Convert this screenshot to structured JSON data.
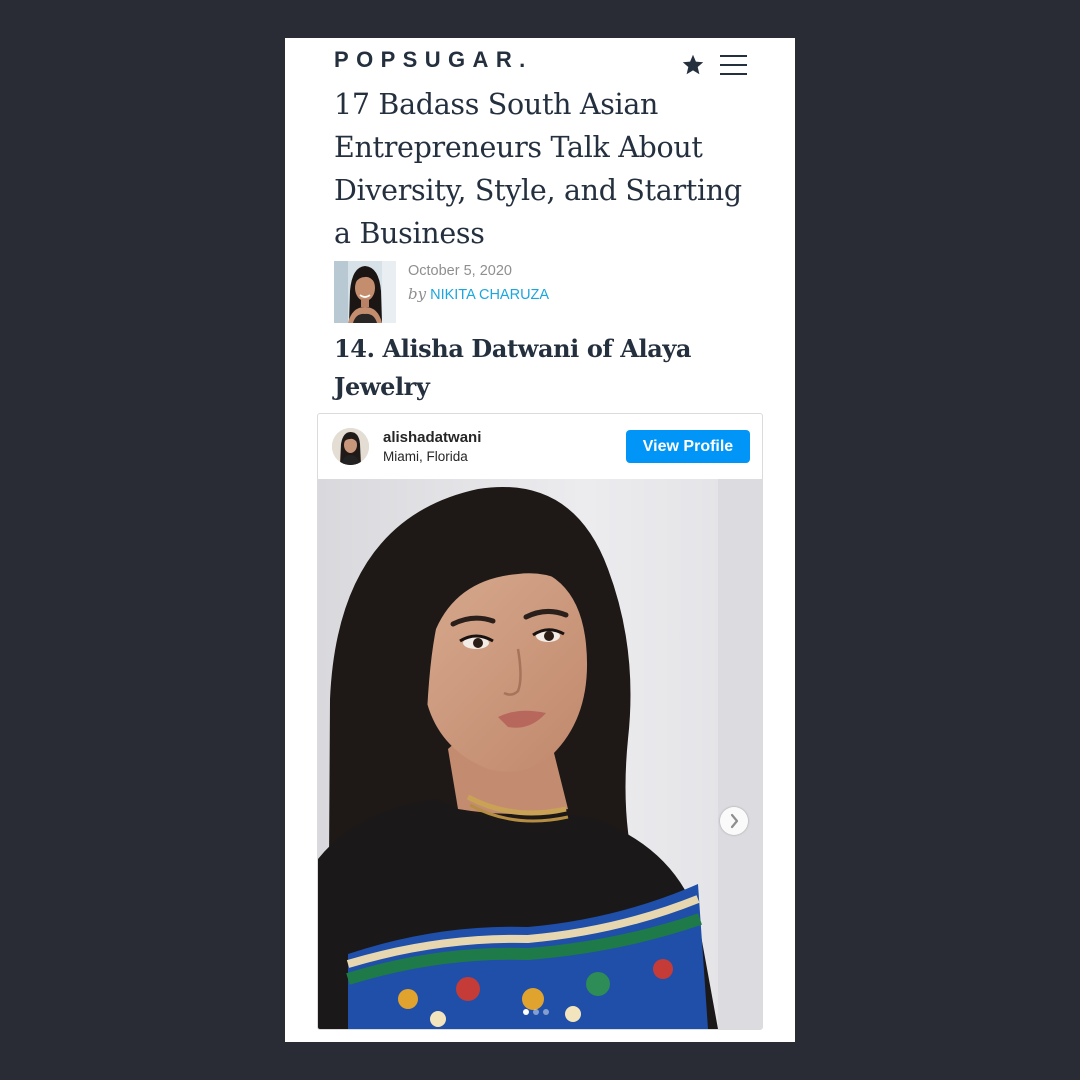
{
  "header": {
    "logo_text": "POPSUGAR.",
    "icons": [
      "star-icon",
      "hamburger-menu-icon"
    ]
  },
  "article": {
    "title": "17 Badass South Asian Entrepreneurs Talk About Diversity, Style, and Starting a Business",
    "date": "October 5, 2020",
    "by_label": "by",
    "author": "NIKITA CHARUZA",
    "section_heading": "14. Alisha Datwani of Alaya Jewelry"
  },
  "instagram_embed": {
    "username": "alishadatwani",
    "location": "Miami, Florida",
    "view_profile_label": "View Profile",
    "carousel_total_slides": 3,
    "carousel_active_slide": 1,
    "icons": [
      "chevron-right-icon"
    ]
  },
  "colors": {
    "background": "#292c34",
    "page": "#ffffff",
    "text_dark": "#25303f",
    "author_link": "#1ca6de",
    "instagram_button": "#0095f6"
  }
}
